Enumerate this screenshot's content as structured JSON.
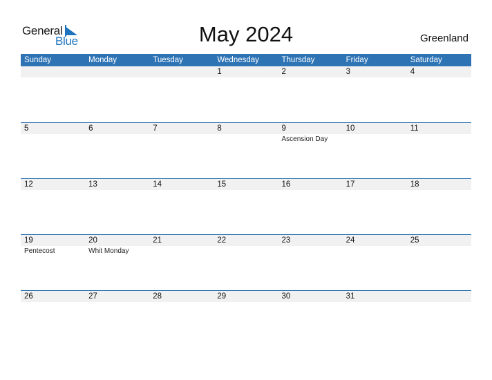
{
  "logo": {
    "word1": "General",
    "word2": "Blue",
    "accent_color": "#1e73be"
  },
  "header": {
    "title": "May 2024",
    "country": "Greenland"
  },
  "colors": {
    "header_bg": "#2e74b5",
    "strip_bg": "#f1f1f1"
  },
  "weekdays": [
    "Sunday",
    "Monday",
    "Tuesday",
    "Wednesday",
    "Thursday",
    "Friday",
    "Saturday"
  ],
  "weeks": [
    {
      "days": [
        "",
        "",
        "",
        "1",
        "2",
        "3",
        "4"
      ],
      "events": [
        "",
        "",
        "",
        "",
        "",
        "",
        ""
      ]
    },
    {
      "days": [
        "5",
        "6",
        "7",
        "8",
        "9",
        "10",
        "11"
      ],
      "events": [
        "",
        "",
        "",
        "",
        "Ascension Day",
        "",
        ""
      ]
    },
    {
      "days": [
        "12",
        "13",
        "14",
        "15",
        "16",
        "17",
        "18"
      ],
      "events": [
        "",
        "",
        "",
        "",
        "",
        "",
        ""
      ]
    },
    {
      "days": [
        "19",
        "20",
        "21",
        "22",
        "23",
        "24",
        "25"
      ],
      "events": [
        "Pentecost",
        "Whit Monday",
        "",
        "",
        "",
        "",
        ""
      ]
    },
    {
      "days": [
        "26",
        "27",
        "28",
        "29",
        "30",
        "31",
        ""
      ],
      "events": [
        "",
        "",
        "",
        "",
        "",
        "",
        ""
      ]
    }
  ]
}
